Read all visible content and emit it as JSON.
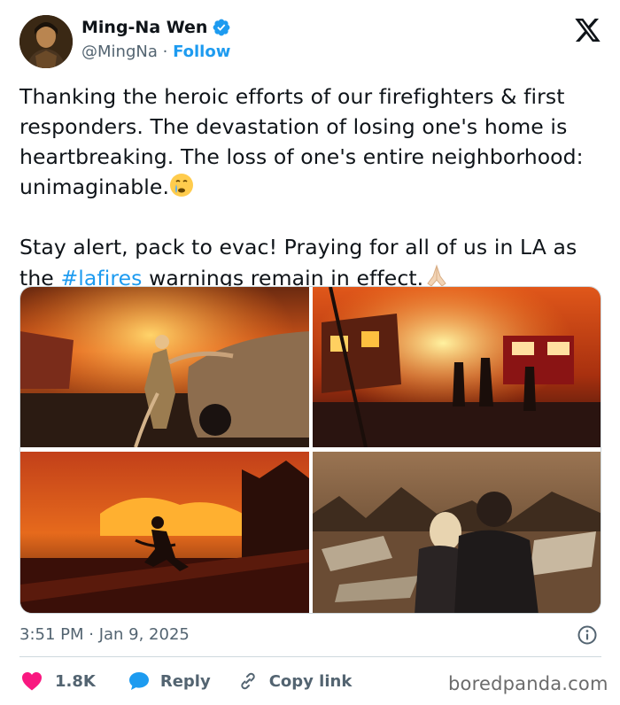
{
  "author": {
    "name": "Ming-Na Wen",
    "handle": "@MingNa",
    "separator": "·",
    "follow_label": "Follow"
  },
  "tweet": {
    "line1": "Thanking the heroic efforts of our firefighters & first responders. The devastation of losing one's home is heartbreaking. The loss of one's entire neighborhood: unimaginable.",
    "emoji1": "crying-face-emoji",
    "line2_before": "Stay alert, pack to evac! Praying for all of us in LA as the ",
    "hashtag": "#lafires",
    "line2_after": " warnings remain in effect.",
    "emoji2": "folded-hands-emoji"
  },
  "media": [
    {
      "icon": "firefighter-hose-car-photo"
    },
    {
      "icon": "burning-building-fire-truck-photo"
    },
    {
      "icon": "firefighter-running-photo"
    },
    {
      "icon": "couple-viewing-ruins-photo"
    }
  ],
  "timestamp": "3:51 PM · Jan 9, 2025",
  "actions": {
    "likes": "1.8K",
    "reply_label": "Reply",
    "copy_label": "Copy link"
  },
  "watermark": "boredpanda.com",
  "colors": {
    "accent": "#1d9bf0",
    "like": "#f91880",
    "text": "#0f1419",
    "muted": "#536471"
  }
}
